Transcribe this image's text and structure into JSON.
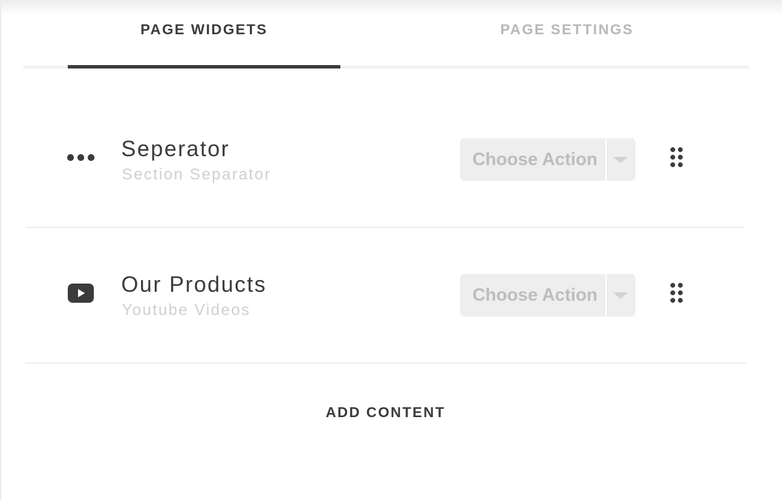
{
  "tabs": [
    {
      "label": "PAGE WIDGETS",
      "active": true
    },
    {
      "label": "PAGE SETTINGS",
      "active": false
    }
  ],
  "widgets": [
    {
      "icon": "ellipsis-icon",
      "title": "Seperator",
      "subtitle": "Section Separator",
      "action_placeholder": "Choose Action"
    },
    {
      "icon": "youtube-icon",
      "title": "Our Products",
      "subtitle": "Youtube Videos",
      "action_placeholder": "Choose Action"
    }
  ],
  "add_content_label": "ADD CONTENT",
  "colors": {
    "text_dark": "#3b3b3d",
    "text_muted": "#b8b8b8",
    "select_bg": "#eeeeee"
  }
}
